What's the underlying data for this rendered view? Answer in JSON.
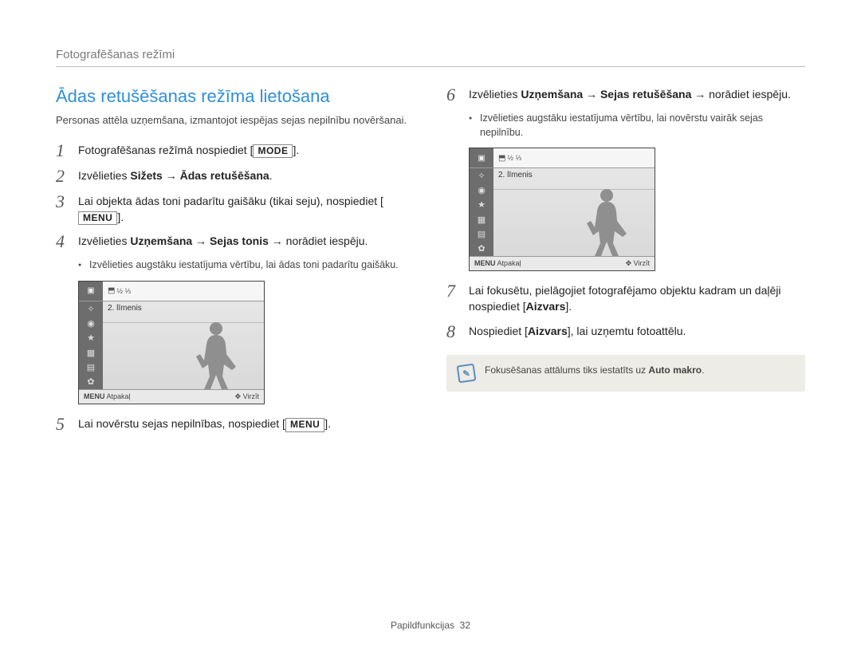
{
  "header": "Fotografēšanas režīmi",
  "title": "Ādas retušēšanas režīma lietošana",
  "intro": "Personas attēla uzņemšana, izmantojot iespējas sejas nepilnību novēršanai.",
  "steps": {
    "s1_a": "Fotografēšanas režīmā nospiediet [",
    "s1_btn": "MODE",
    "s1_b": "].",
    "s2_a": "Izvēlieties ",
    "s2_b": "Sižets",
    "s2_c": " → ",
    "s2_d": "Ādas retušēšana",
    "s2_e": ".",
    "s3_a": "Lai objekta ādas toni padarītu gaišāku (tikai seju), nospiediet [",
    "s3_btn": "MENU",
    "s3_b": "].",
    "s4_a": "Izvēlieties ",
    "s4_b": "Uzņemšana",
    "s4_c": " → ",
    "s4_d": "Sejas tonis",
    "s4_e": " → norādiet iespēju.",
    "s4_sub": "Izvēlieties augstāku iestatījuma vērtību, lai ādas toni padarītu gaišāku.",
    "s5_a": "Lai novērstu sejas nepilnības, nospiediet [",
    "s5_btn": "MENU",
    "s5_b": "].",
    "s6_a": "Izvēlieties ",
    "s6_b": "Uzņemšana",
    "s6_c": " → ",
    "s6_d": "Sejas retušēšana",
    "s6_e": " → norādiet iespēju.",
    "s6_sub": "Izvēlieties augstāku iestatījuma vērtību, lai novērstu vairāk sejas nepilnību.",
    "s7_a": "Lai fokusētu, pielāgojiet fotografējamo objektu kadram un daļēji nospiediet [",
    "s7_b": "Aizvars",
    "s7_c": "].",
    "s8_a": "Nospiediet [",
    "s8_b": "Aizvars",
    "s8_c": "], lai uzņemtu fotoattēlu."
  },
  "screen": {
    "level": "2. līmenis",
    "menu": "MENU",
    "back": "Atpakaļ",
    "move": "Virzīt"
  },
  "note": {
    "text_a": "Fokusēšanas attālums tiks iestatīts uz ",
    "text_b": "Auto makro",
    "text_c": "."
  },
  "footer": {
    "label": "Papildfunkcijas",
    "page": "32"
  }
}
